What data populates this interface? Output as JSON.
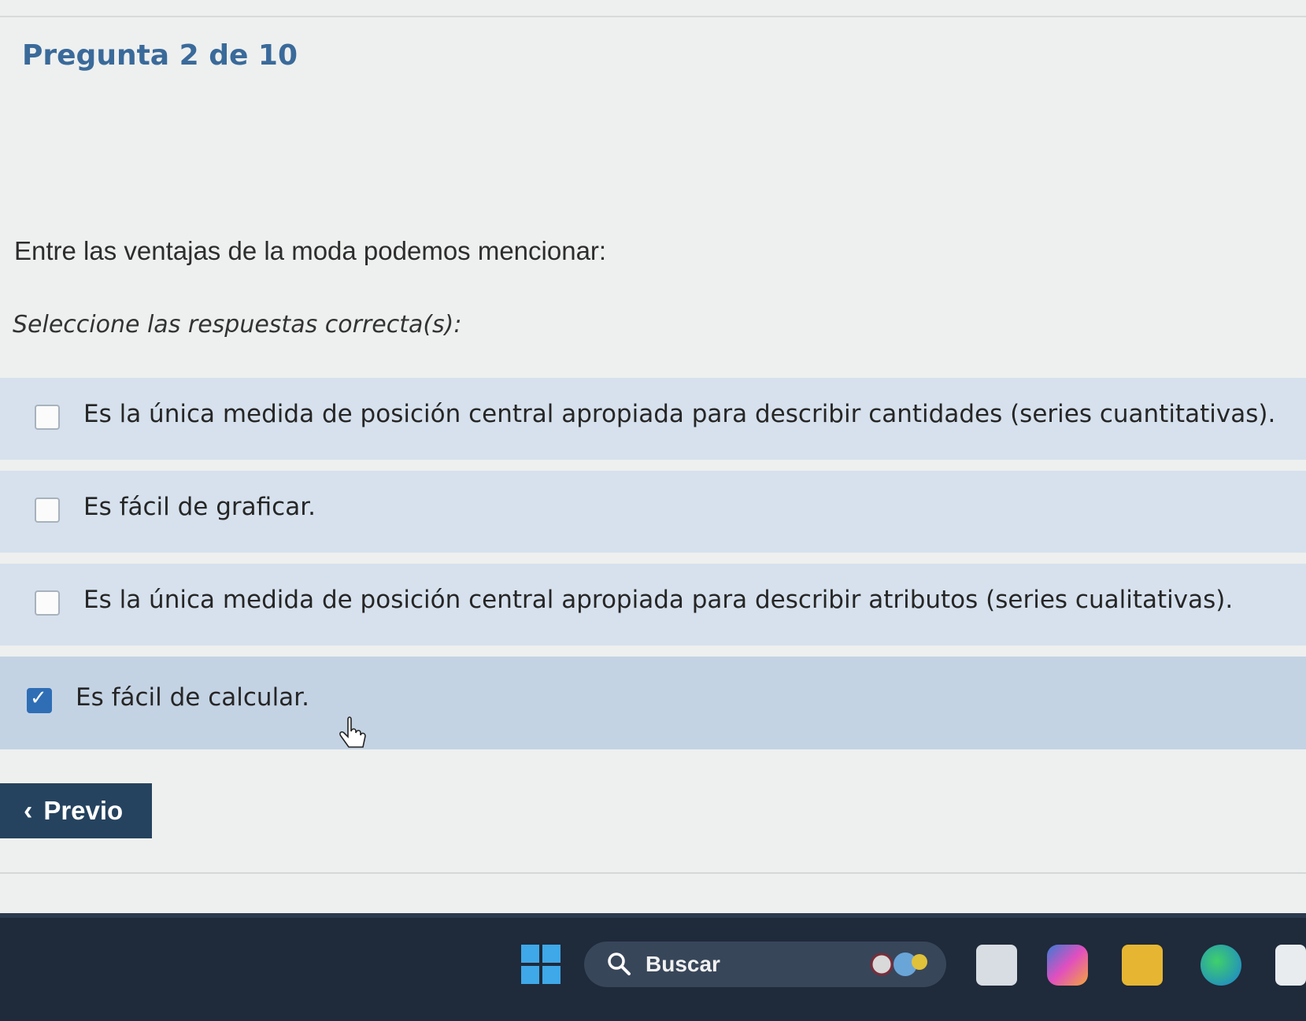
{
  "question": {
    "number_label": "Pregunta 2 de 10",
    "text": "Entre las ventajas de la moda podemos mencionar:",
    "instruction": "Seleccione las respuestas correcta(s):"
  },
  "options": [
    {
      "label": "Es la única medida de posición central apropiada para describir cantidades (series cuantitativas).",
      "checked": false
    },
    {
      "label": "Es fácil de graficar.",
      "checked": false
    },
    {
      "label": "Es la única medida de posición central apropiada para describir atributos (series cualitativas).",
      "checked": false
    },
    {
      "label": "Es fácil de calcular.",
      "checked": true
    }
  ],
  "navigation": {
    "previous_label": "Previo",
    "previous_icon": "chevron-left-icon"
  },
  "taskbar": {
    "search_label": "Buscar",
    "apps": [
      "start-icon",
      "search-icon",
      "task-view-icon",
      "copilot-icon",
      "file-explorer-icon",
      "edge-icon",
      "store-icon"
    ]
  },
  "colors": {
    "question_number": "#3a6a9a",
    "option_bg": "#d6e1ed",
    "option_selected_bg": "#c4d3e4",
    "checkbox_checked": "#2f6eb5",
    "previous_button": "#25435f",
    "taskbar": "#1f2a3a"
  }
}
